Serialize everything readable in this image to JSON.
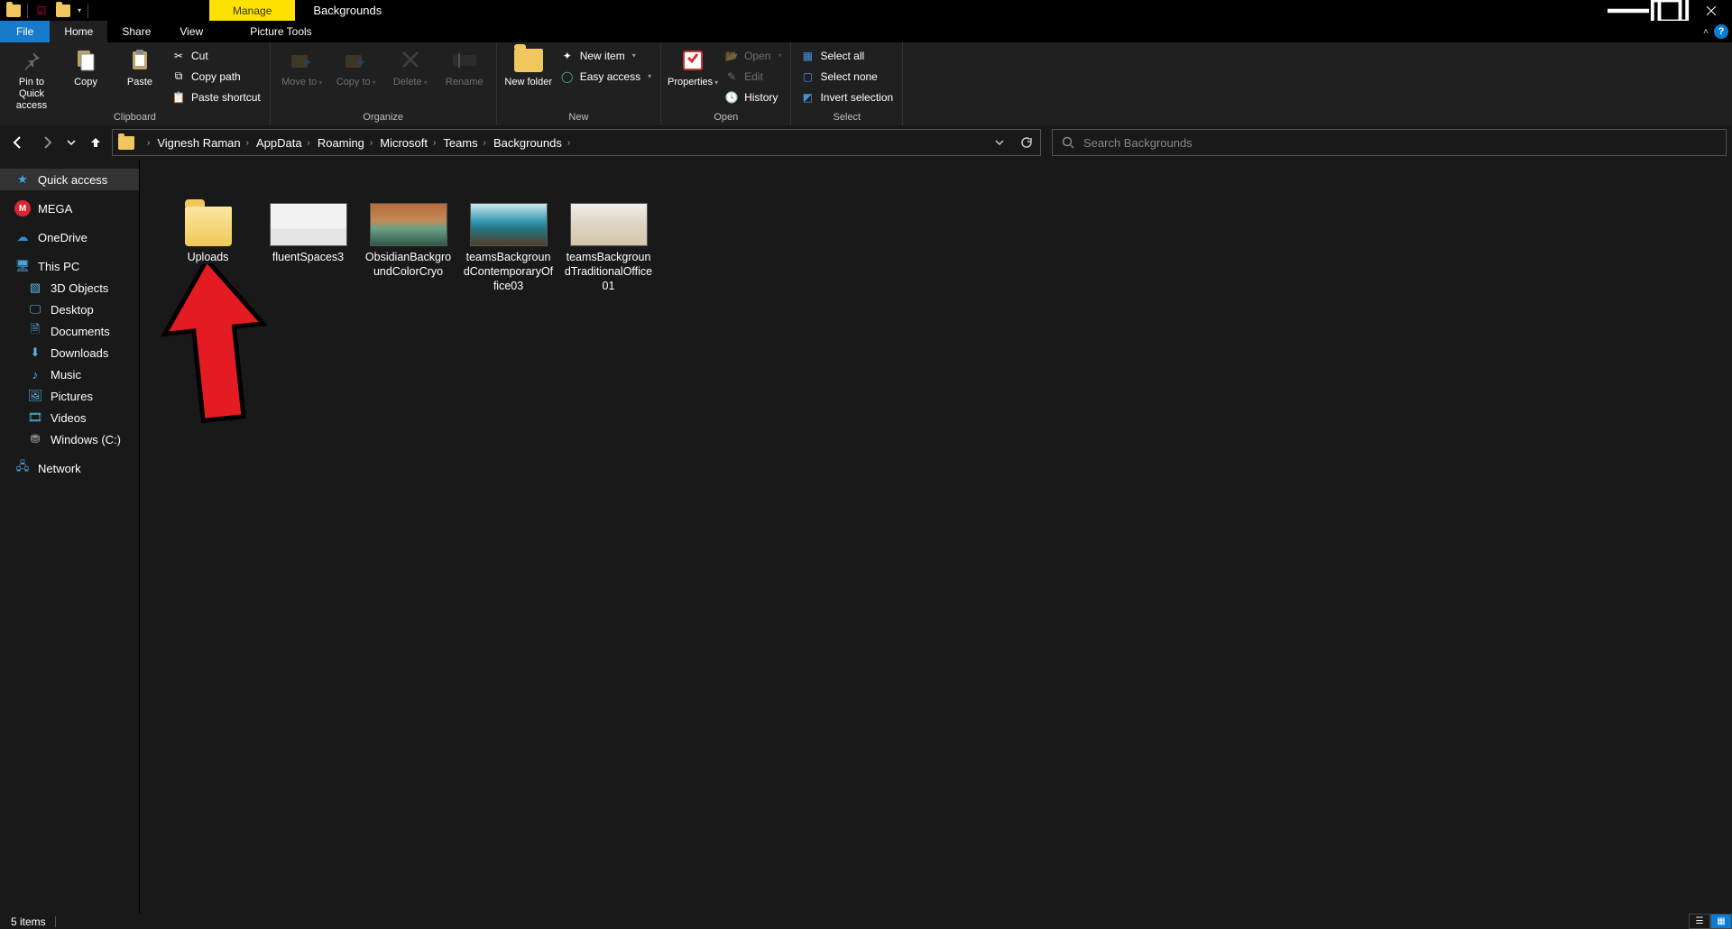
{
  "titlebar": {
    "context_tab": "Manage",
    "window_title": "Backgrounds"
  },
  "tabs": {
    "file": "File",
    "home": "Home",
    "share": "Share",
    "view": "View",
    "picture_tools": "Picture Tools"
  },
  "ribbon": {
    "clipboard": {
      "label": "Clipboard",
      "pin": "Pin to Quick access",
      "copy": "Copy",
      "paste": "Paste",
      "cut": "Cut",
      "copy_path": "Copy path",
      "paste_shortcut": "Paste shortcut"
    },
    "organize": {
      "label": "Organize",
      "move_to": "Move to",
      "copy_to": "Copy to",
      "delete": "Delete",
      "rename": "Rename"
    },
    "new": {
      "label": "New",
      "new_folder": "New folder",
      "new_item": "New item",
      "easy_access": "Easy access"
    },
    "open": {
      "label": "Open",
      "properties": "Properties",
      "open": "Open",
      "edit": "Edit",
      "history": "History"
    },
    "select": {
      "label": "Select",
      "select_all": "Select all",
      "select_none": "Select none",
      "invert": "Invert selection"
    }
  },
  "breadcrumbs": [
    "Vignesh Raman",
    "AppData",
    "Roaming",
    "Microsoft",
    "Teams",
    "Backgrounds"
  ],
  "search": {
    "placeholder": "Search Backgrounds"
  },
  "sidebar": {
    "quick_access": "Quick access",
    "mega": "MEGA",
    "onedrive": "OneDrive",
    "this_pc": "This PC",
    "pc_children": [
      "3D Objects",
      "Desktop",
      "Documents",
      "Downloads",
      "Music",
      "Pictures",
      "Videos",
      "Windows (C:)"
    ],
    "network": "Network"
  },
  "items": {
    "uploads": "Uploads",
    "fluent": "fluentSpaces3",
    "obsidian": "ObsidianBackgroundColorCryo",
    "contemp": "teamsBackgroundContemporaryOffice03",
    "trad": "teamsBackgroundTraditionalOffice01"
  },
  "status": {
    "count": "5 items"
  },
  "colors": {
    "accent": "#1979ca",
    "context_highlight": "#ffe100",
    "folder": "#f0c75e"
  }
}
